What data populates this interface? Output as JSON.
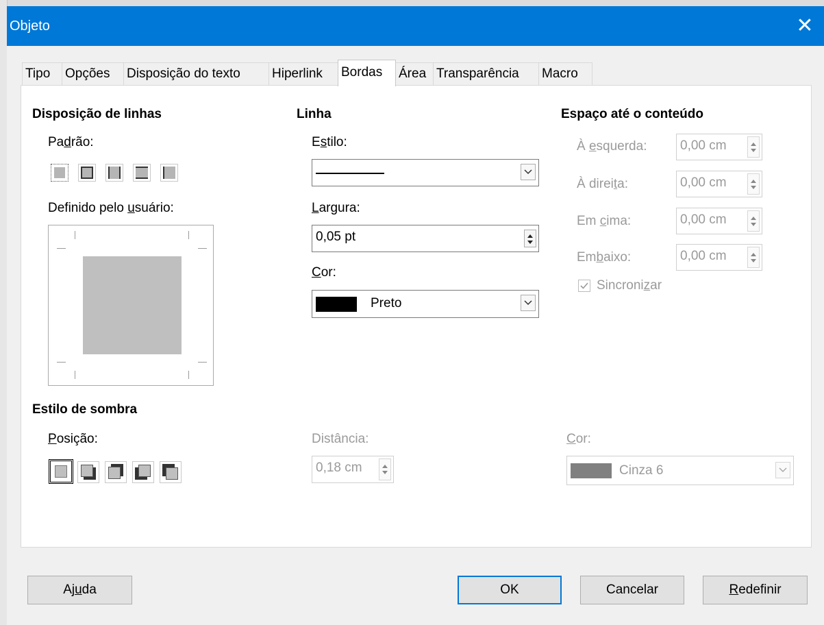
{
  "window": {
    "title": "Objeto",
    "close_glyph": "✕"
  },
  "tabs": [
    {
      "label": "Tipo"
    },
    {
      "label": "Opções"
    },
    {
      "label": "Disposição do texto"
    },
    {
      "label": "Hiperlink"
    },
    {
      "label": "Bordas",
      "active": true
    },
    {
      "label": "Área"
    },
    {
      "label": "Transparência"
    },
    {
      "label": "Macro"
    }
  ],
  "line_arrangement": {
    "heading": "Disposição de linhas",
    "default_label_pre": "Pa",
    "default_label_key": "d",
    "default_label_post": "rão:",
    "user_label_pre": "Definido pelo ",
    "user_label_key": "u",
    "user_label_post": "suário:",
    "presets": [
      "no-border-icon",
      "outer-border-icon",
      "left-right-border-icon",
      "top-bottom-border-icon",
      "left-border-icon"
    ]
  },
  "line": {
    "heading": "Linha",
    "style_label_pre": "E",
    "style_label_key": "s",
    "style_label_post": "tilo:",
    "width_label_pre": "",
    "width_label_key": "L",
    "width_label_post": "argura:",
    "width_value": "0,05 pt",
    "color_label_key": "C",
    "color_label_post": "or:",
    "color_value": "Preto",
    "color_swatch": "#000000"
  },
  "spacing": {
    "heading": "Espaço até o conteúdo",
    "left_label_pre": "À ",
    "left_label_key": "e",
    "left_label_post": "squerda:",
    "left_value": "0,00 cm",
    "right_label_pre": "À direi",
    "right_label_key": "t",
    "right_label_post": "a:",
    "right_value": "0,00 cm",
    "top_label_pre": "Em ",
    "top_label_key": "c",
    "top_label_post": "ima:",
    "top_value": "0,00 cm",
    "bottom_label_pre": "Em",
    "bottom_label_key": "b",
    "bottom_label_post": "aixo:",
    "bottom_value": "0,00 cm",
    "sync_label_pre": "Sincroni",
    "sync_label_key": "z",
    "sync_label_post": "ar",
    "sync_checked": true
  },
  "shadow": {
    "heading": "Estilo de sombra",
    "position_label_key": "P",
    "position_label_post": "osição:",
    "distance_label": "Distância:",
    "distance_value": "0,18 cm",
    "color_label_key": "C",
    "color_label_post": "or:",
    "color_value": "Cinza 6",
    "color_swatch": "#808080",
    "positions": [
      "no-shadow-icon",
      "shadow-bottom-right-icon",
      "shadow-top-right-icon",
      "shadow-bottom-left-icon",
      "shadow-top-left-icon"
    ]
  },
  "buttons": {
    "help_pre": "Aj",
    "help_key": "u",
    "help_post": "da",
    "ok": "OK",
    "cancel": "Cancelar",
    "reset_key": "R",
    "reset_post": "edefinir"
  }
}
